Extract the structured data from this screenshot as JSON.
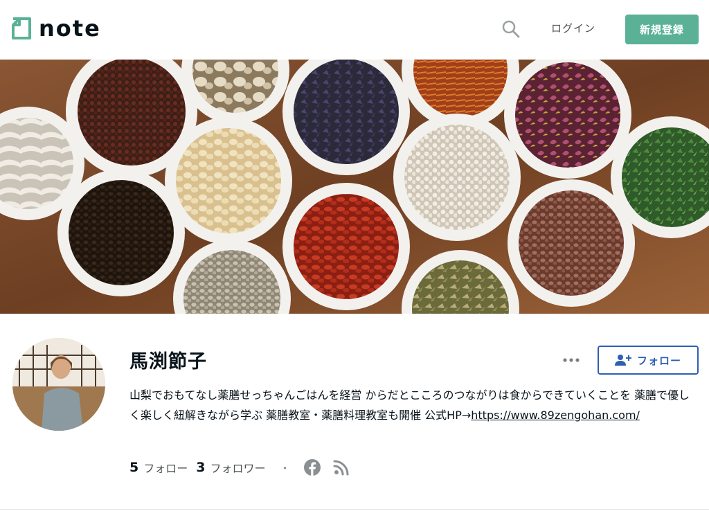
{
  "header": {
    "logo_text": "note",
    "login_label": "ログイン",
    "signup_label": "新規登録",
    "accent_color": "#5ab196"
  },
  "profile": {
    "name": "馬渕節子",
    "bio_text": "山梨でおもてなし薬膳せっちゃんごはんを経営 からだとこころのつながりは食からできていくことを 薬膳で優しく楽しく紐解きながら学ぶ 薬膳教室・薬膳料理教室も開催 公式HP→",
    "bio_link": "https://www.89zengohan.com/",
    "follow_label": "フォロー",
    "follow_color": "#2f5fb3"
  },
  "stats": {
    "following_count": "5",
    "following_label": "フォロー",
    "followers_count": "3",
    "followers_label": "フォロワー",
    "separator": "・"
  },
  "icons": [
    "note-logo-icon",
    "search-icon",
    "more-icon",
    "add-user-icon",
    "facebook-icon",
    "rss-icon"
  ]
}
